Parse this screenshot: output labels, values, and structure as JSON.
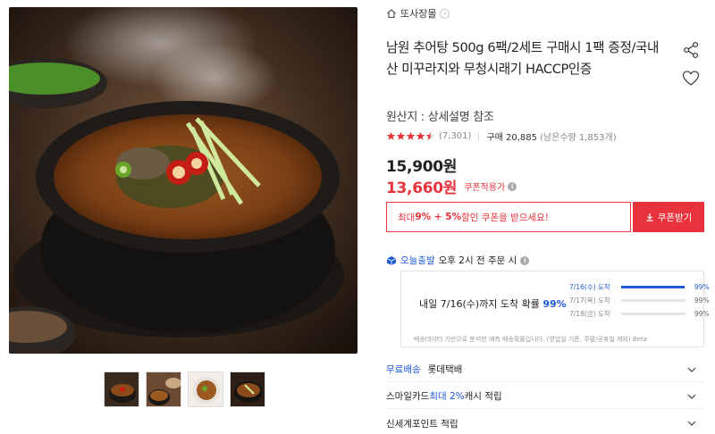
{
  "store": {
    "name": "또사장몰",
    "chevron_icon": "chevron-right-icon"
  },
  "product": {
    "title": "남원 추어탕 500g 6팩/2세트 구매시 1팩 증정/국내산 미꾸라지와 무청시래기 HACCP인증",
    "origin": "원산지 : 상세설명 참조",
    "rating": 4.5,
    "review_count": "(7,301)",
    "purchase_count": "구매 20,885",
    "remaining": "(남은수량 1,853개)",
    "price": "15,900원",
    "coupon_price": "13,660원",
    "coupon_applied_label": "쿠폰적용가"
  },
  "coupon": {
    "message_prefix": "최대 ",
    "message_highlight": "9% + 5%",
    "message_suffix": " 할인 쿠폰을 받으세요!",
    "button_label": "쿠폰받기"
  },
  "today_delivery": {
    "label": "오늘출발",
    "text": "오후 2시 전 주문 시",
    "probability_text": "내일 7/16(수)까지 도착 확률",
    "probability_value": "99%",
    "rows": [
      {
        "date": "7/16(수) 도착",
        "value": "99%",
        "fill": 0.99
      },
      {
        "date": "7/17(목) 도착",
        "value": "99%",
        "fill": 0
      },
      {
        "date": "7/18(금) 도착",
        "value": "99%",
        "fill": 0
      }
    ],
    "note": "배송데이터 기반으로 분석한 예측 배송확률입니다. (영업일 기준, 주말/공휴일 제외)",
    "beta": "Beta"
  },
  "accordion": {
    "shipping_label": "무료배송",
    "shipping_courier": "롯데택배",
    "card_prefix": "스마일카드 ",
    "card_highlight": "최대 2%",
    "card_suffix": " 캐시 적립",
    "points_label": "신세계포인트 적립"
  },
  "colors": {
    "accent_red": "#e8323c",
    "accent_blue": "#1f5bd6"
  }
}
